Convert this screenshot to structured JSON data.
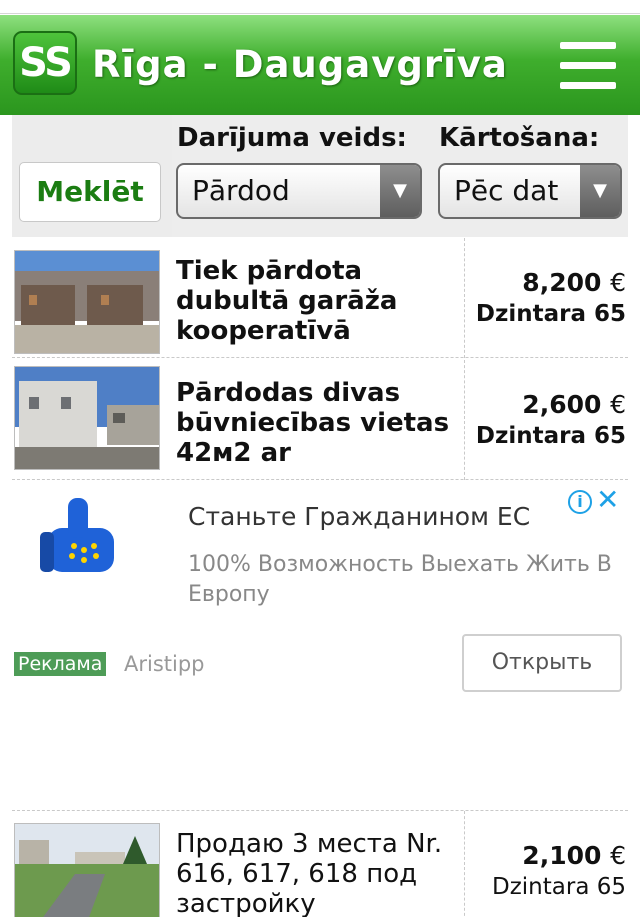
{
  "header": {
    "logo_text": "SS",
    "title": "Rīga - Daugavgrīva",
    "menu_icon": "hamburger-menu-icon",
    "colors": {
      "green_top": "#8ee07f",
      "green_bottom": "#2b961e",
      "accent_text": "#1b7d12"
    }
  },
  "filters": {
    "search_label": "Meklēt",
    "deal_type_label": "Darījuma veids:",
    "deal_type_value": "Pārdod",
    "sort_label": "Kārtošana:",
    "sort_value": "Pēc dat"
  },
  "listings": [
    {
      "title": "Tiek pārdota dubultā garāža kooperatīvā",
      "price": "8,200",
      "currency": "€",
      "street": "Dzintara 65"
    },
    {
      "title": "Pārdodas divas būvniecības vietas 42м2 ar",
      "price": "2,600",
      "currency": "€",
      "street": "Dzintara 65"
    },
    {
      "title": "Продаю 3 места Nr. 616, 617, 618 под застройку",
      "price": "2,100",
      "currency": "€",
      "street": "Dzintara 65"
    }
  ],
  "promo": {
    "title": "Станьте Гражданином ЕС",
    "text": "100% Возможность Выехать Жить В Европу",
    "tag": "Реклама",
    "source": "Aristipp",
    "open_label": "Открыть",
    "icons": [
      "thumbs-up-eu-icon",
      "info-icon",
      "close-icon"
    ]
  }
}
